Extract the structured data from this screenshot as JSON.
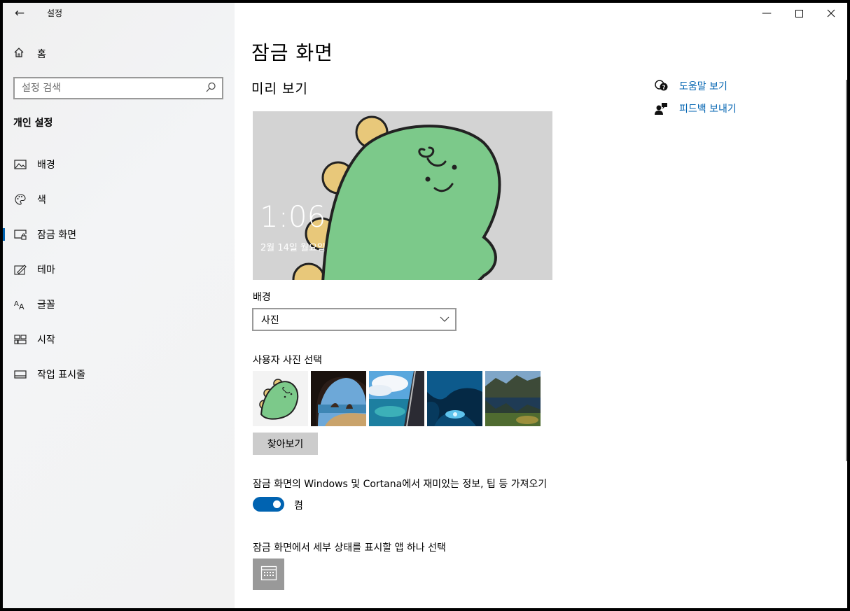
{
  "app": {
    "title": "설정"
  },
  "sidebar": {
    "home_label": "홈",
    "search_placeholder": "설정 검색",
    "section_header": "개인 설정",
    "items": [
      {
        "label": "배경",
        "icon": "image-icon",
        "active": false
      },
      {
        "label": "색",
        "icon": "palette-icon",
        "active": false
      },
      {
        "label": "잠금 화면",
        "icon": "lock-screen-icon",
        "active": true
      },
      {
        "label": "테마",
        "icon": "theme-icon",
        "active": false
      },
      {
        "label": "글꼴",
        "icon": "font-icon",
        "active": false
      },
      {
        "label": "시작",
        "icon": "start-icon",
        "active": false
      },
      {
        "label": "작업 표시줄",
        "icon": "taskbar-icon",
        "active": false
      }
    ]
  },
  "main": {
    "title": "잠금 화면",
    "preview_header": "미리 보기",
    "preview": {
      "time": "1:06",
      "date": "2월 14일 월요일"
    },
    "background_label": "배경",
    "background_value": "사진",
    "choose_photo_label": "사용자 사진 선택",
    "browse_label": "찾아보기",
    "fun_facts_label": "잠금 화면의 Windows 및 Cortana에서 재미있는 정보, 팁 등 가져오기",
    "toggle_state": "켬",
    "toggle_on": true,
    "detailed_status_label": "잠금 화면에서 세부 상태를 표시할 앱 하나 선택"
  },
  "help": {
    "get_help": "도움말 보기",
    "give_feedback": "피드백 보내기"
  },
  "colors": {
    "accent": "#0063b1",
    "preview_bg": "#d3d3d3",
    "dino_green": "#7cc98a"
  }
}
